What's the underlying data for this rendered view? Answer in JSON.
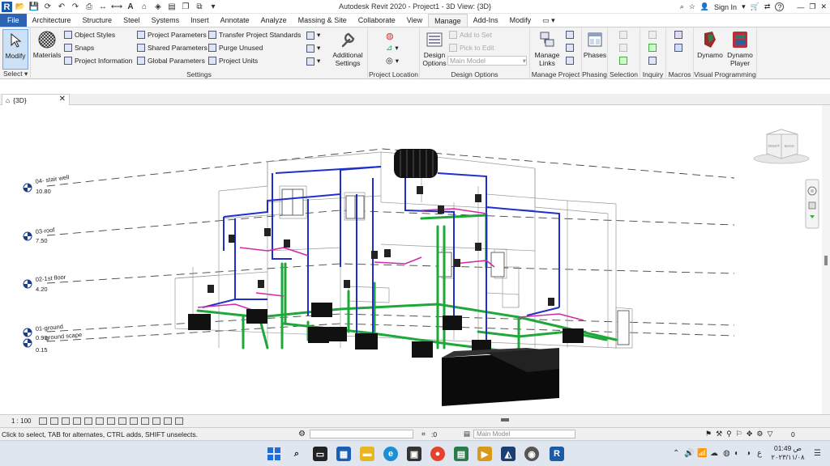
{
  "app": {
    "title": "Autodesk Revit 2020 - Project1 - 3D View: {3D}",
    "sign_in": "Sign In",
    "help": "?"
  },
  "tabs": [
    "File",
    "Architecture",
    "Structure",
    "Steel",
    "Systems",
    "Insert",
    "Annotate",
    "Analyze",
    "Massing & Site",
    "Collaborate",
    "View",
    "Manage",
    "Add-Ins",
    "Modify"
  ],
  "active_tab": "Manage",
  "ribbon": {
    "select": {
      "modify": "Modify",
      "group": "Select"
    },
    "settings": {
      "materials": "Materials",
      "object_styles": "Object  Styles",
      "snaps": "Snaps",
      "project_information": "Project  Information",
      "project_parameters": "Project  Parameters",
      "shared_parameters": "Shared  Parameters",
      "global_parameters": "Global  Parameters",
      "transfer_project_standards": "Transfer  Project Standards",
      "purge_unused": "Purge  Unused",
      "project_units": "Project  Units",
      "additional_settings_1": "Additional",
      "additional_settings_2": "Settings",
      "group": "Settings"
    },
    "project_location": {
      "group": "Project Location"
    },
    "design_options": {
      "btn_1": "Design",
      "btn_2": "Options",
      "add_to_set": "Add to Set",
      "pick_to_edit": "Pick to Edit",
      "main_model": "Main Model",
      "group": "Design Options"
    },
    "manage_project": {
      "btn_1": "Manage",
      "btn_2": "Links",
      "group": "Manage Project"
    },
    "phasing": {
      "btn": "Phases",
      "group": "Phasing"
    },
    "selection": {
      "group": "Selection"
    },
    "inquiry": {
      "group": "Inquiry"
    },
    "macros": {
      "group": "Macros"
    },
    "visual_programming": {
      "dynamo": "Dynamo",
      "player_1": "Dynamo",
      "player_2": "Player",
      "group": "Visual Programming"
    }
  },
  "view_tab": {
    "label": "{3D}",
    "close": "✕"
  },
  "levels": [
    {
      "name": "04- stair well",
      "elev": "10.80"
    },
    {
      "name": "03-roof",
      "elev": "7.50"
    },
    {
      "name": "02-1st floor",
      "elev": "4.20"
    },
    {
      "name": "01-ground",
      "elev": "0.90"
    },
    {
      "name": "ground scape",
      "elev": "0.15"
    }
  ],
  "viewcube": {
    "right": "RIGHT",
    "back": "BACK"
  },
  "viewbar": {
    "scale": "1 : 100"
  },
  "statusbar": {
    "message": "Click to select, TAB for alternates, CTRL adds, SHIFT unselects.",
    "zero": ":0",
    "model": "Main Model",
    "filter_count": "0"
  },
  "taskbar": {
    "time": "01:49 ص",
    "date": "٢٠٢٣/١١/٠٨",
    "lang": "ع"
  },
  "colors": {
    "file_tab": "#2c64b3",
    "pipe_green": "#1fa83a",
    "pipe_blue": "#1f2fc9",
    "pipe_magenta": "#d02aa8"
  }
}
